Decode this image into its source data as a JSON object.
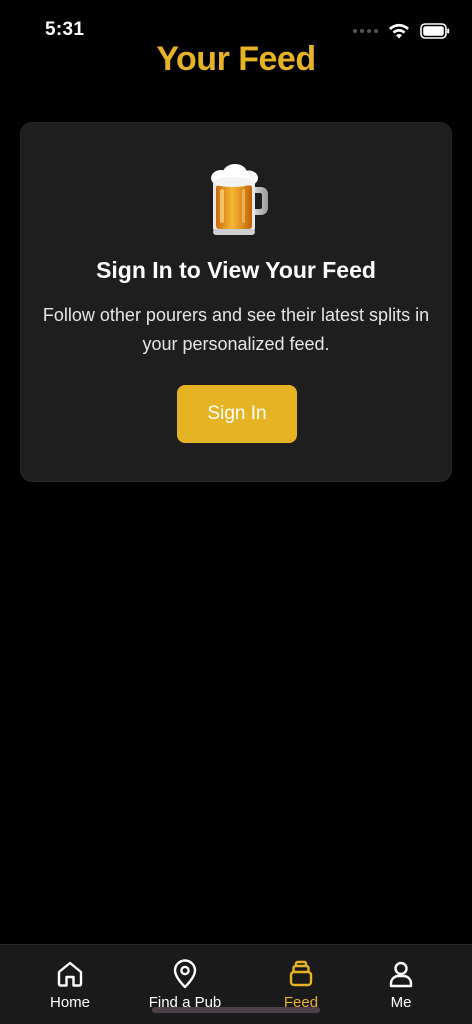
{
  "status_bar": {
    "time": "5:31"
  },
  "header": {
    "title": "Your Feed"
  },
  "card": {
    "icon": "beer-mug-icon",
    "title": "Sign In to View Your Feed",
    "description": "Follow other pourers and see their latest splits in your personalized feed.",
    "button_label": "Sign In"
  },
  "tab_bar": {
    "items": [
      {
        "label": "Home",
        "icon": "home-icon",
        "active": false
      },
      {
        "label": "Find a Pub",
        "icon": "location-pin-icon",
        "active": false
      },
      {
        "label": "Feed",
        "icon": "feed-icon",
        "active": true
      },
      {
        "label": "Me",
        "icon": "person-icon",
        "active": false
      }
    ]
  },
  "colors": {
    "accent": "#e6b325",
    "background": "#000000",
    "card": "#1e1e1e",
    "tab_bar": "#1a1a1a"
  }
}
